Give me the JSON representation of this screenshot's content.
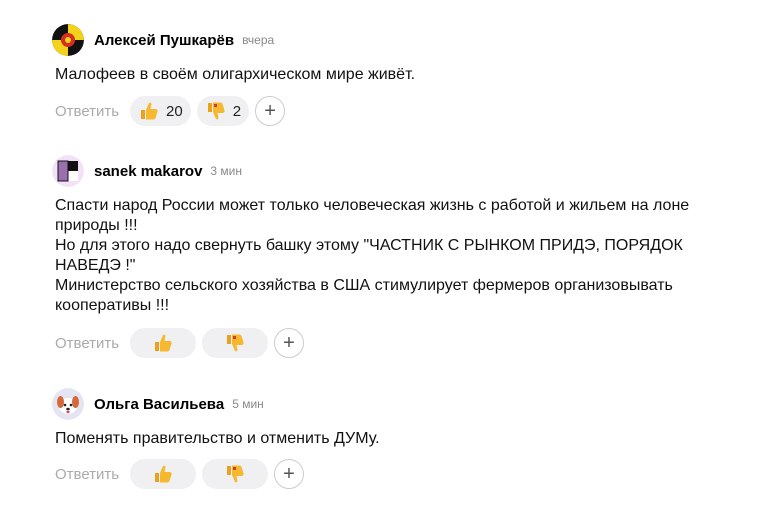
{
  "comments": [
    {
      "author": "Алексей Пушкарёв",
      "time": "вчера",
      "avatar_icon": "yellow-black-emblem-avatar",
      "lines": [
        "Малофеев в своём олигархическом мире живёт."
      ],
      "reply_label": "Ответить",
      "likes": "20",
      "dislikes": "2"
    },
    {
      "author": "sanek makarov",
      "time": "3 мин",
      "avatar_icon": "purple-black-white-avatar",
      "lines": [
        "Спасти народ России может только человеческая жизнь с работой и жильем на лоне природы !!!",
        "Но для этого надо свернуть башку этому \"ЧАСТНИК С РЫНКОМ ПРИДЭ, ПОРЯДОК НАВЕДЭ !\"",
        "Министерство сельского хозяйства в США стимулирует фермеров организовывать кооперативы !!!"
      ],
      "reply_label": "Ответить",
      "likes": "",
      "dislikes": ""
    },
    {
      "author": "Ольга Васильева",
      "time": "5 мин",
      "avatar_icon": "puppy-avatar",
      "lines": [
        "Поменять правительство и отменить ДУМу."
      ],
      "reply_label": "Ответить",
      "likes": "",
      "dislikes": ""
    }
  ],
  "icons": {
    "like": "thumbs-up-icon",
    "dislike": "thumbs-down-icon",
    "add_reaction": "plus-icon"
  },
  "colors": {
    "reply": "#aaaaaa",
    "reaction_bg": "#f0f0f2",
    "emoji_yellow": "#f5b82e"
  }
}
